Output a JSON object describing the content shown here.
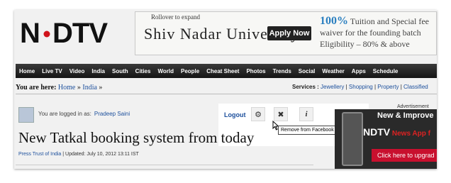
{
  "logo": {
    "text": "NDTV"
  },
  "ad": {
    "rollover": "Rollover to expand",
    "university": "Shiv Nadar University",
    "apply_label": "Apply Now",
    "line1_big": "100%",
    "line1_rest": " Tuition and Special fee",
    "line2": "waiver for the founding batch",
    "line3": "Eligibility – 80% & above"
  },
  "nav": {
    "items": [
      "Home",
      "Live TV",
      "Video",
      "India",
      "South",
      "Cities",
      "World",
      "People",
      "Cheat Sheet",
      "Photos",
      "Trends",
      "Social",
      "Weather",
      "Apps",
      "Schedule"
    ]
  },
  "breadcrumb": {
    "label": "You are here:",
    "home": "Home",
    "sep": " » ",
    "india": "India",
    "end": " »"
  },
  "services": {
    "label": "Services :",
    "items": [
      "Jewellery",
      "Shopping",
      "Property",
      "Classified"
    ]
  },
  "login": {
    "text": "You are logged in as:",
    "name": "Pradeep Saini",
    "logout": "Logout"
  },
  "icons": {
    "settings": "⚙",
    "remove": "✖",
    "info": "i"
  },
  "tooltip": "Remove from Facebook timeline",
  "article": {
    "headline": "New Tatkal booking system from today",
    "source": "Press Trust of India",
    "updated": " | Updated: July 10, 2012 13:11 IST"
  },
  "right_ad": {
    "label": "Advertisement",
    "title": "New & Improve",
    "brand": "NDTV",
    "brand_rest": " News App f",
    "cta": "Click here to upgrad"
  }
}
